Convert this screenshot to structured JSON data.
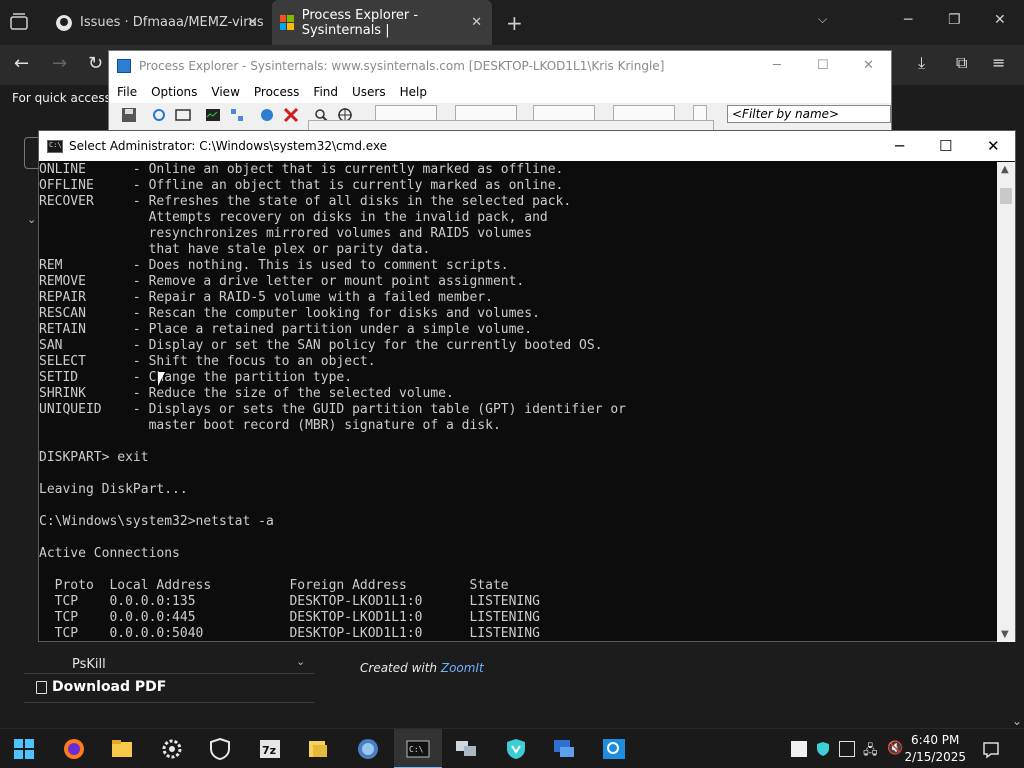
{
  "browser": {
    "tabs": [
      {
        "label": "Issues · Dfmaaa/MEMZ-virus",
        "icon": "github-icon"
      },
      {
        "label": "Process Explorer - Sysinternals |",
        "icon": "microsoft-icon"
      }
    ],
    "quick_access": "For quick access, p"
  },
  "process_explorer": {
    "title": "Process Explorer - Sysinternals: www.sysinternals.com [DESKTOP-LKOD1L1\\Kris Kringle]",
    "menu": [
      "File",
      "Options",
      "View",
      "Process",
      "Find",
      "Users",
      "Help"
    ],
    "filter_placeholder": "<Filter by name>"
  },
  "cmd": {
    "title": "Select Administrator: C:\\Windows\\system32\\cmd.exe",
    "lines": [
      "ONLINE      - Online an object that is currently marked as offline.",
      "OFFLINE     - Offline an object that is currently marked as online.",
      "RECOVER     - Refreshes the state of all disks in the selected pack.",
      "              Attempts recovery on disks in the invalid pack, and",
      "              resynchronizes mirrored volumes and RAID5 volumes",
      "              that have stale plex or parity data.",
      "REM         - Does nothing. This is used to comment scripts.",
      "REMOVE      - Remove a drive letter or mount point assignment.",
      "REPAIR      - Repair a RAID-5 volume with a failed member.",
      "RESCAN      - Rescan the computer looking for disks and volumes.",
      "RETAIN      - Place a retained partition under a simple volume.",
      "SAN         - Display or set the SAN policy for the currently booted OS.",
      "SELECT      - Shift the focus to an object.",
      "SETID       - Change the partition type.",
      "SHRINK      - Reduce the size of the selected volume.",
      "UNIQUEID    - Displays or sets the GUID partition table (GPT) identifier or",
      "              master boot record (MBR) signature of a disk.",
      "",
      "DISKPART> exit",
      "",
      "Leaving DiskPart...",
      "",
      "C:\\Windows\\system32>netstat -a",
      "",
      "Active Connections",
      "",
      "  Proto  Local Address          Foreign Address        State",
      "  TCP    0.0.0.0:135            DESKTOP-LKOD1L1:0      LISTENING",
      "  TCP    0.0.0.0:445            DESKTOP-LKOD1L1:0      LISTENING",
      "  TCP    0.0.0.0:5040           DESKTOP-LKOD1L1:0      LISTENING"
    ]
  },
  "page": {
    "pskill": "PsKill",
    "download_pdf": "Download PDF",
    "created_with": "Created with ",
    "zoomit": "ZoomIt"
  },
  "taskbar": {
    "time": "6:40 PM",
    "date": "2/15/2025",
    "pinned": [
      "start-icon",
      "firefox-icon",
      "file-explorer-icon",
      "settings-icon",
      "security-icon",
      "7zip-icon",
      "folder-app-icon",
      "browser-globe-icon",
      "cmd-icon",
      "network-computers-icon",
      "vpn-icon",
      "remote-desktop-icon",
      "magnifier-icon"
    ]
  }
}
